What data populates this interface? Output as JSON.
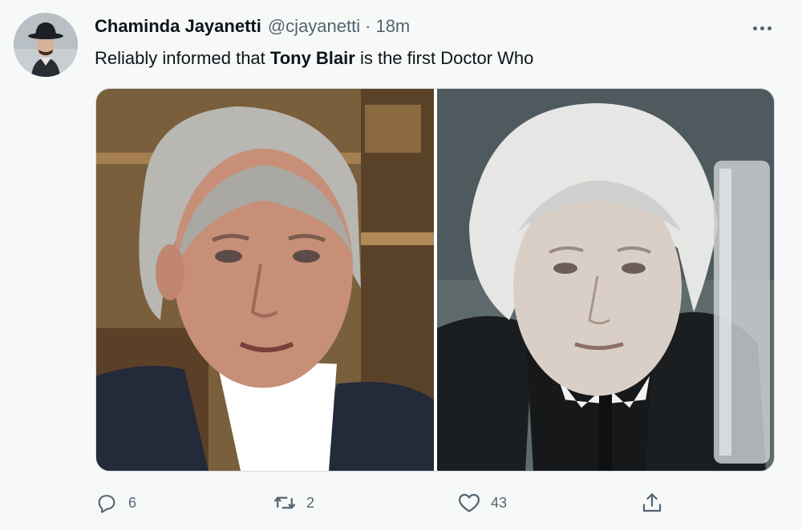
{
  "tweet": {
    "author_name": "Chaminda Jayanetti",
    "author_handle": "@cjayanetti",
    "separator": "·",
    "timestamp": "18m",
    "text_before": "Reliably informed that ",
    "text_bold": "Tony Blair",
    "text_after": " is the first Doctor Who",
    "actions": {
      "reply_count": "6",
      "retweet_count": "2",
      "like_count": "43"
    }
  },
  "icons": {
    "more": "more-horizontal-icon",
    "reply": "reply-bubble-icon",
    "retweet": "retweet-icon",
    "like": "heart-icon",
    "share": "share-upload-icon"
  },
  "colors": {
    "background": "#f7f9f9",
    "text_primary": "#0f1419",
    "text_secondary": "#536471",
    "border": "#cfd9de"
  }
}
